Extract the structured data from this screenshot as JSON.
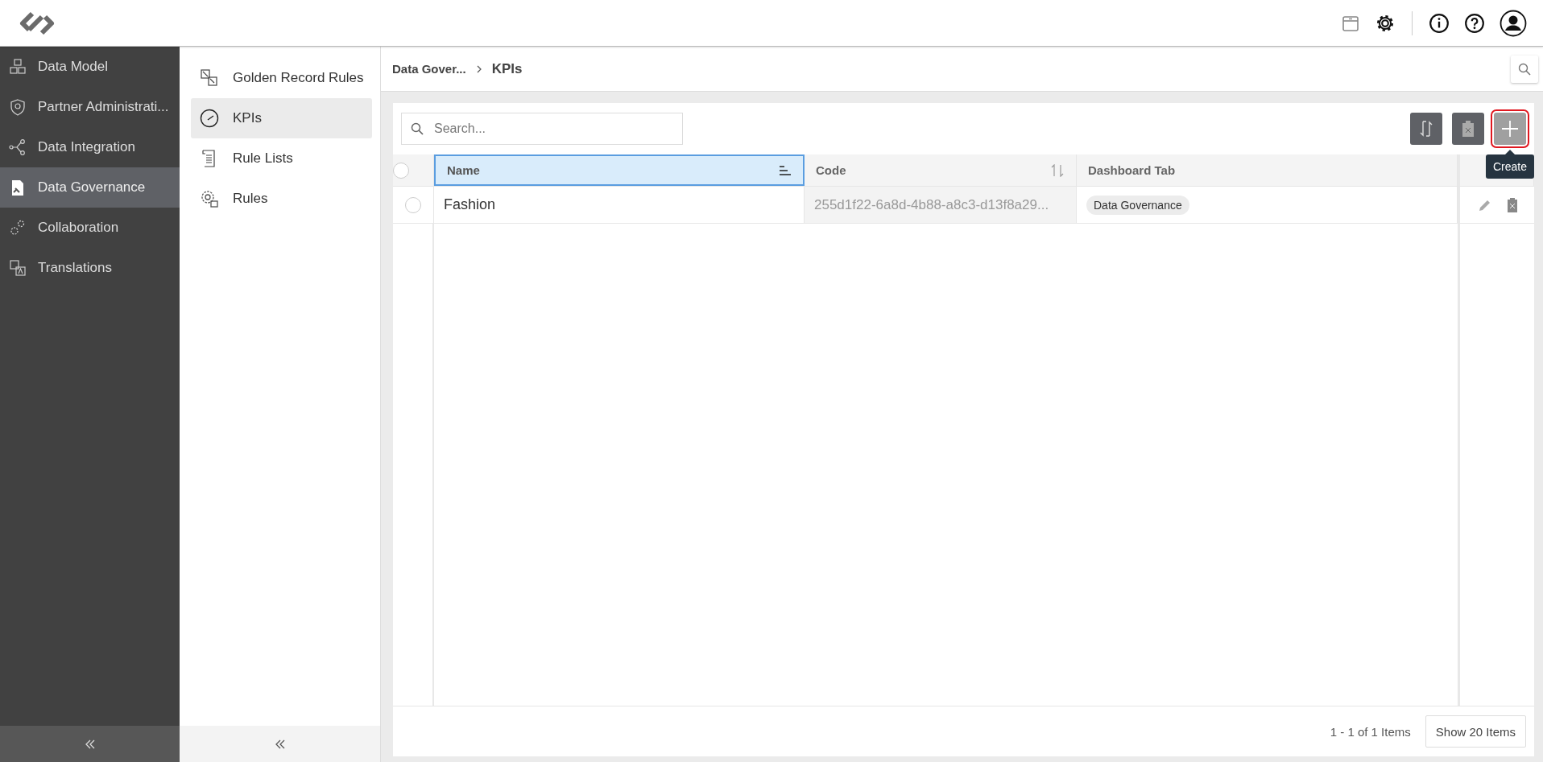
{
  "nav": [
    {
      "label": "Data Model",
      "selected": false
    },
    {
      "label": "Partner Administrati...",
      "selected": false
    },
    {
      "label": "Data Integration",
      "selected": false
    },
    {
      "label": "Data Governance",
      "selected": true
    },
    {
      "label": "Collaboration",
      "selected": false
    },
    {
      "label": "Translations",
      "selected": false
    }
  ],
  "subnav": [
    {
      "label": "Golden Record Rules",
      "selected": false
    },
    {
      "label": "KPIs",
      "selected": true
    },
    {
      "label": "Rule Lists",
      "selected": false
    },
    {
      "label": "Rules",
      "selected": false
    }
  ],
  "breadcrumb": [
    "Data Gover...",
    "KPIs"
  ],
  "search": {
    "placeholder": "Search..."
  },
  "tooltip": "Create",
  "table": {
    "all_checked": false,
    "columns": [
      {
        "label": "Name",
        "kind": "sorted",
        "selected": true
      },
      {
        "label": "Code",
        "kind": "sortable",
        "selected": false
      },
      {
        "label": "Dashboard Tab",
        "kind": "plain",
        "selected": false
      }
    ],
    "rows": [
      {
        "checked": false,
        "name": "Fashion",
        "code": "255d1f22-6a8d-4b88-a8c3-d13f8a29...",
        "dashboard_tab": "Data Governance"
      }
    ]
  },
  "pager": {
    "summary": "1 - 1 of 1 Items",
    "page_size": "Show 20 Items"
  }
}
